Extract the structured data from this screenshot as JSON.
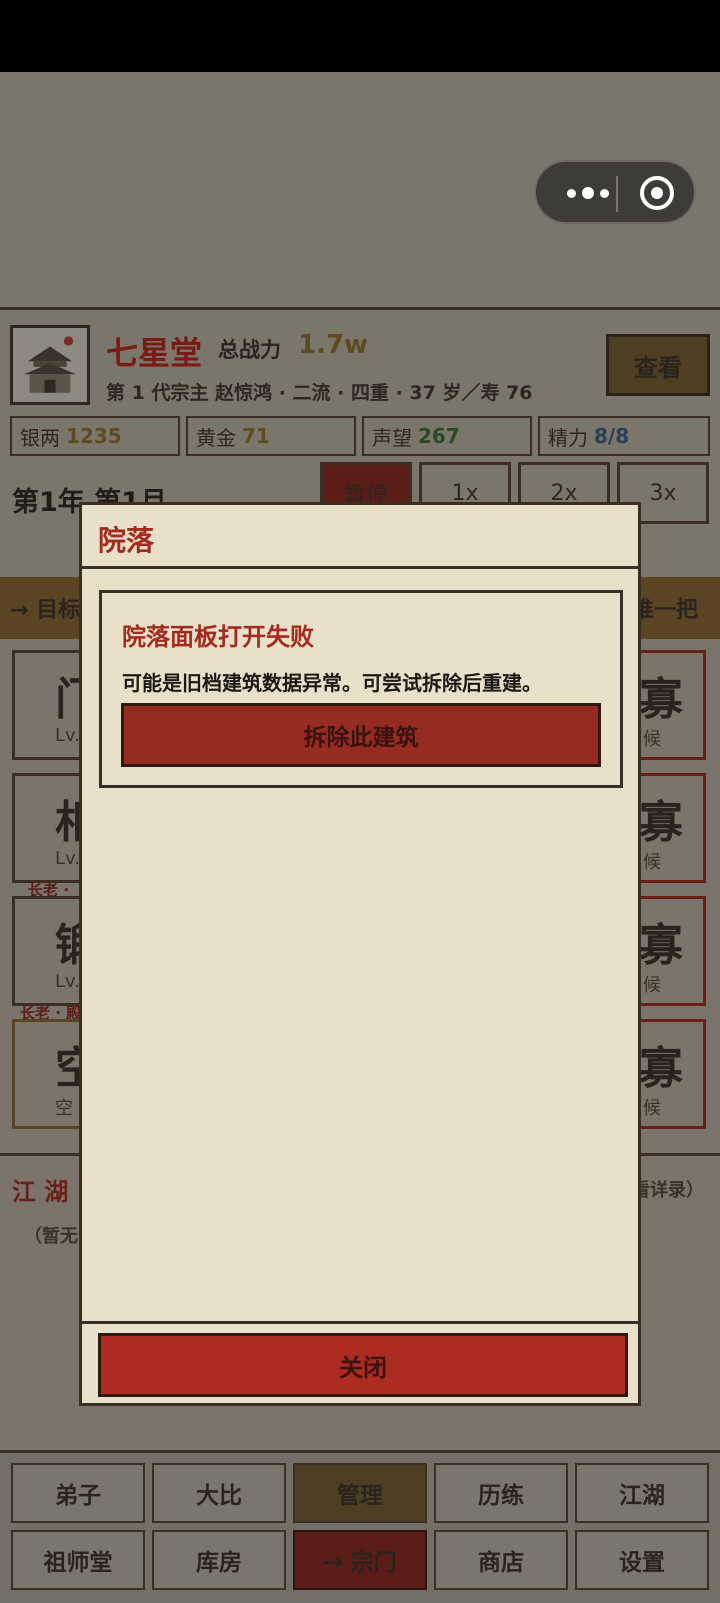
{
  "header": {
    "sect_name": "七星堂",
    "power_label": "总战力",
    "power_value": "1.7w",
    "view_button": "查看",
    "leader_line": "第 1 代宗主 赵惊鸿 · 二流 · 四重 · 37 岁／寿 76"
  },
  "resources": [
    {
      "label": "银两",
      "value": "1235",
      "color": "#7a6330"
    },
    {
      "label": "黄金",
      "value": "71",
      "color": "#7a6330"
    },
    {
      "label": "声望",
      "value": "267",
      "color": "#2f5a2a"
    },
    {
      "label": "精力",
      "value": "8/8",
      "color": "#2f4a6a"
    }
  ],
  "time": {
    "date": "第1年 第1月",
    "speed_buttons": [
      "暂停",
      "1x",
      "2x",
      "3x"
    ]
  },
  "goal_bar": {
    "left": "→ 目标",
    "right": "推一把"
  },
  "buildings": {
    "left": [
      {
        "char": "门",
        "level": "Lv."
      },
      {
        "char": "相",
        "level": "Lv.",
        "elder": "长老 ·"
      },
      {
        "char": "锻",
        "level": "Lv.",
        "elder": "长老 · 殿"
      },
      {
        "char": "空",
        "level": "空"
      }
    ],
    "right": [
      {
        "char": "寡",
        "sub": "候"
      },
      {
        "char": "寡",
        "sub": "候"
      },
      {
        "char": "寡",
        "sub": "候"
      },
      {
        "char": "寡",
        "sub": "候"
      }
    ]
  },
  "jianghu": {
    "title": "江 湖",
    "link": "看详录）",
    "empty": "（暂无"
  },
  "nav": {
    "row1": [
      "弟子",
      "大比",
      "管理",
      "历练",
      "江湖"
    ],
    "row2": [
      "祖师堂",
      "库房",
      "→ 宗门",
      "商店",
      "设置"
    ]
  },
  "modal": {
    "title": "院落",
    "error_title": "院落面板打开失败",
    "error_message": "可能是旧档建筑数据异常。可尝试拆除后重建。",
    "demolish_button": "拆除此建筑",
    "close_button": "关闭"
  },
  "capsule": {
    "menu_icon": "more-dots-icon",
    "close_icon": "target-circle-icon"
  }
}
